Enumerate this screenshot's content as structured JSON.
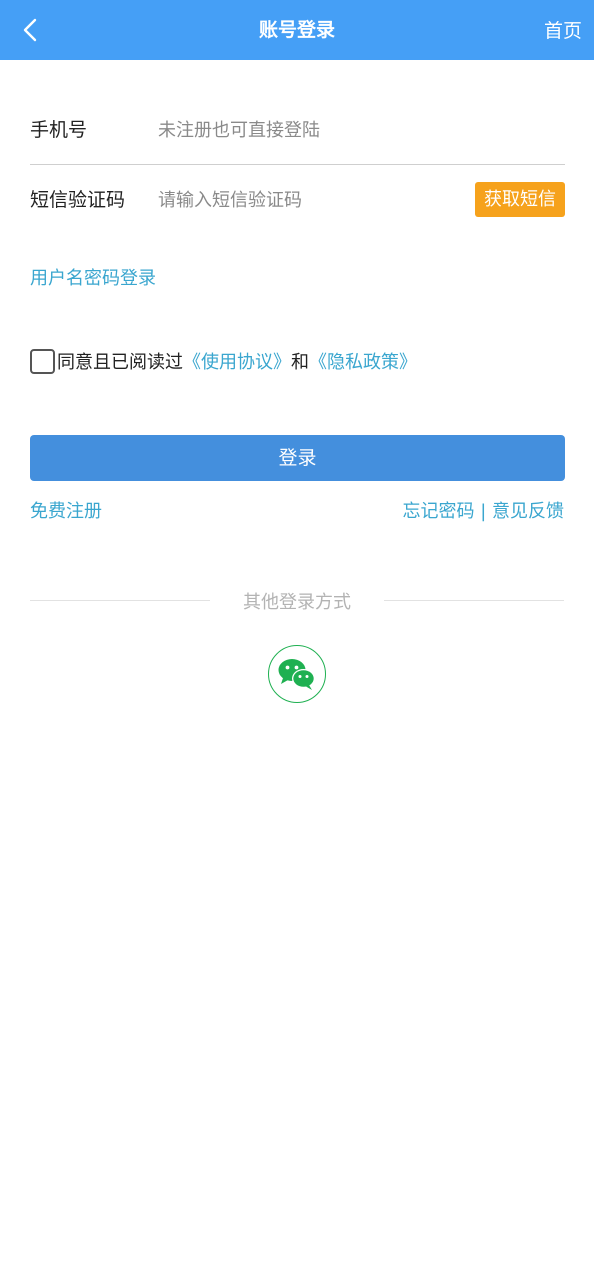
{
  "header": {
    "title": "账号登录",
    "home_label": "首页"
  },
  "form": {
    "phone_label": "手机号",
    "phone_placeholder": "未注册也可直接登陆",
    "sms_label": "短信验证码",
    "sms_placeholder": "请输入短信验证码",
    "sms_button": "获取短信"
  },
  "password_login_link": "用户名密码登录",
  "agreement": {
    "text_prefix": "同意且已阅读过",
    "terms_link": "《使用协议》",
    "and_text": "和",
    "privacy_link": "《隐私政策》"
  },
  "login_button": "登录",
  "links": {
    "register": "免费注册",
    "forgot_password": "忘记密码",
    "separator": " | ",
    "feedback": "意见反馈"
  },
  "other_login": {
    "label": "其他登录方式",
    "methods": [
      {
        "icon": "wechat-icon",
        "color": "#1fb051"
      }
    ]
  },
  "colors": {
    "header_bg": "#459ff6",
    "login_button_bg": "#448fdd",
    "sms_button_bg": "#f6a21c",
    "link": "#3aa6cf"
  }
}
